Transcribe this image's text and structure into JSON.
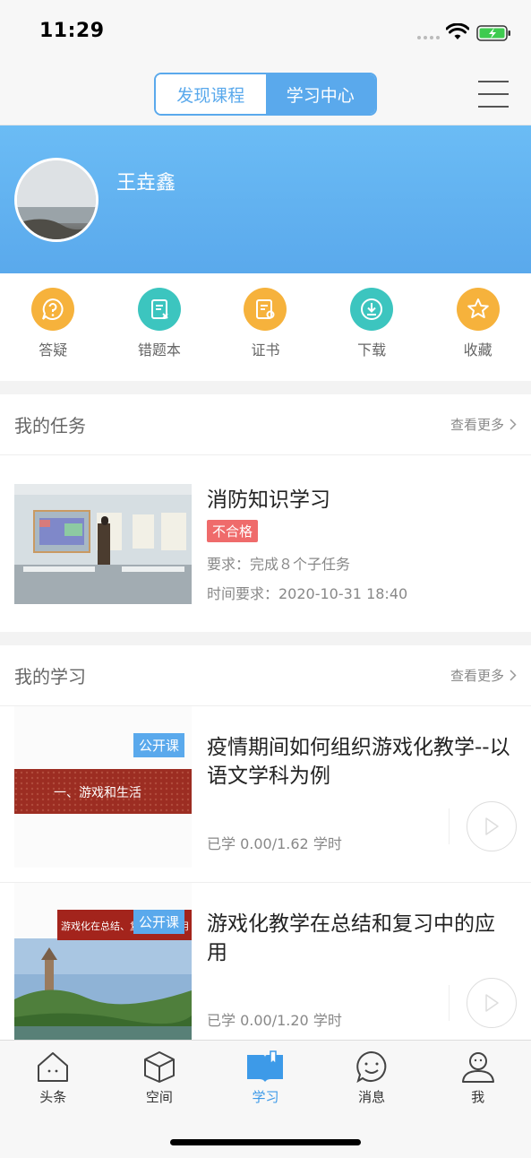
{
  "status": {
    "time": "11:29"
  },
  "nav": {
    "tabs": [
      {
        "label": "发现课程",
        "active": false
      },
      {
        "label": "学习中心",
        "active": true
      }
    ],
    "menu_icon": "hamburger-icon"
  },
  "profile": {
    "name": "王垚鑫"
  },
  "quick": [
    {
      "label": "答疑",
      "icon": "question-bubble-icon",
      "color": "#f6b23c"
    },
    {
      "label": "错题本",
      "icon": "error-notebook-icon",
      "color": "#3cc5bf"
    },
    {
      "label": "证书",
      "icon": "certificate-icon",
      "color": "#f6b23c"
    },
    {
      "label": "下载",
      "icon": "download-icon",
      "color": "#3cc5bf"
    },
    {
      "label": "收藏",
      "icon": "star-icon",
      "color": "#f6b23c"
    }
  ],
  "tasks": {
    "title": "我的任务",
    "more": "查看更多",
    "items": [
      {
        "title": "消防知识学习",
        "status": "不合格",
        "requirement": "要求：完成８个子任务",
        "deadline": "时间要求：2020-10-31 18:40"
      }
    ]
  },
  "learning": {
    "title": "我的学习",
    "more": "查看更多",
    "items": [
      {
        "badge": "公开课",
        "thumb_text": "一、游戏和生活",
        "title": "疫情期间如何组织游戏化教学--以语文学科为例",
        "progress": "已学 0.00/1.62 学时"
      },
      {
        "badge": "公开课",
        "thumb_text": "游戏化在总结、复习中的应用",
        "title": "游戏化教学在总结和复习中的应用",
        "progress": "已学 0.00/1.20 学时"
      }
    ]
  },
  "tabbar": [
    {
      "label": "头条",
      "icon": "house-icon",
      "active": false
    },
    {
      "label": "空间",
      "icon": "cube-icon",
      "active": false
    },
    {
      "label": "学习",
      "icon": "book-icon",
      "active": true
    },
    {
      "label": "消息",
      "icon": "chat-smile-icon",
      "active": false
    },
    {
      "label": "我",
      "icon": "person-icon",
      "active": false
    }
  ],
  "colors": {
    "accent": "#5aa9ec",
    "fail": "#ef6b6b",
    "orange": "#f6b23c",
    "teal": "#3cc5bf"
  }
}
